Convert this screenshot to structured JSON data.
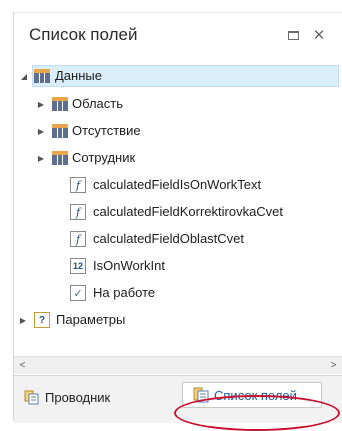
{
  "panel": {
    "title": "Список полей",
    "restore_icon": "restore-window-icon",
    "close_glyph": "✕"
  },
  "tree": {
    "root": {
      "label": "Данные",
      "expanded": true,
      "icon": "table-icon"
    },
    "groups": [
      {
        "label": "Область",
        "icon": "table-icon"
      },
      {
        "label": "Отсутствие",
        "icon": "table-icon"
      },
      {
        "label": "Сотрудник",
        "icon": "table-icon"
      }
    ],
    "fields": [
      {
        "label": "calculatedFieldIsOnWorkText",
        "icon": "function-icon",
        "glyph": "f"
      },
      {
        "label": "calculatedFieldKorrektirovkaCvet",
        "icon": "function-icon",
        "glyph": "f"
      },
      {
        "label": "calculatedFieldOblastCvet",
        "icon": "function-icon",
        "glyph": "f"
      },
      {
        "label": "IsOnWorkInt",
        "icon": "number-icon",
        "glyph": "12"
      },
      {
        "label": "На работе",
        "icon": "boolean-icon",
        "glyph": "✓"
      }
    ],
    "params": {
      "label": "Параметры",
      "icon": "parameter-icon",
      "glyph": "?"
    }
  },
  "scrollbar": {
    "left_glyph": "<",
    "right_glyph": ">"
  },
  "tabs": [
    {
      "label": "Проводник",
      "icon": "explorer-icon",
      "active": false
    },
    {
      "label": "Список полей",
      "icon": "field-list-icon",
      "active": true
    }
  ],
  "colors": {
    "selection": "#ddeefb",
    "highlight_ring": "#c8102e",
    "active_tab_text": "#1c5fa8"
  }
}
